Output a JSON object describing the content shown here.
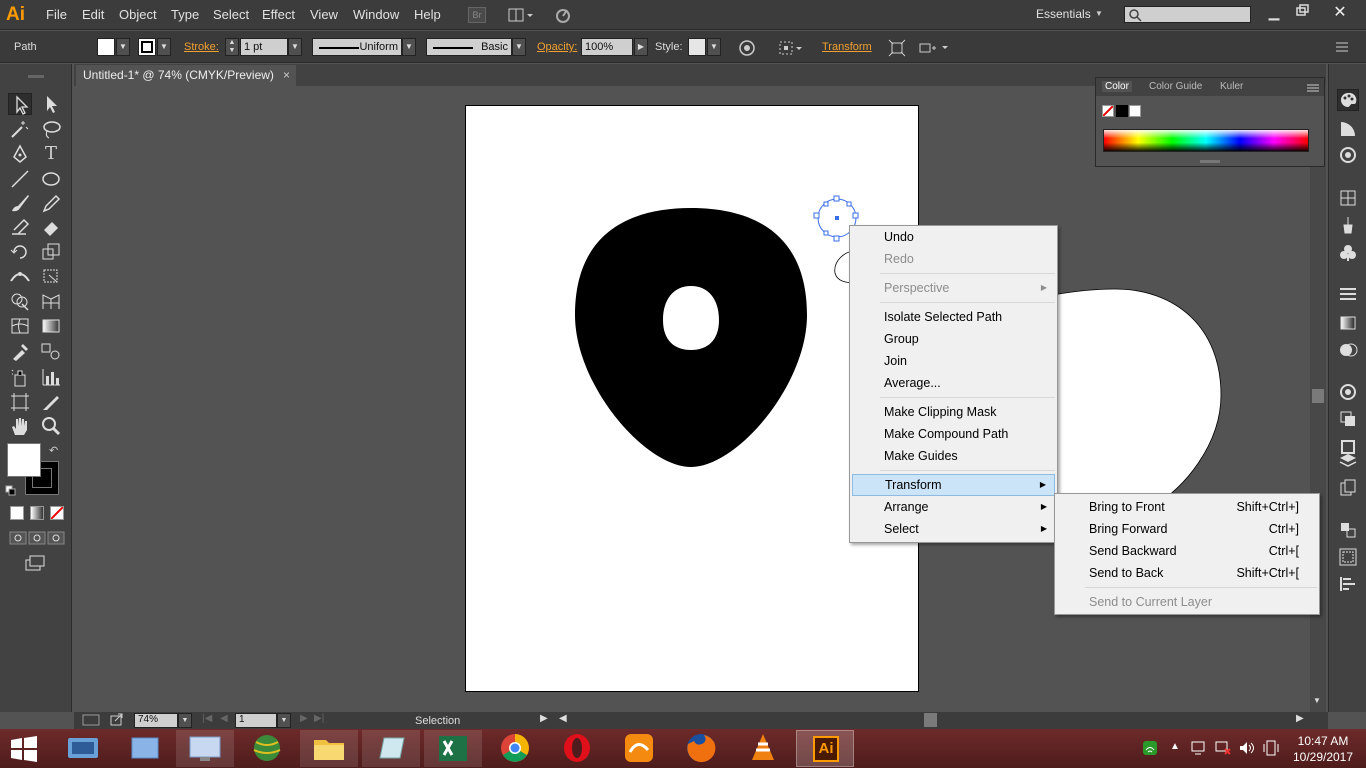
{
  "app": {
    "logo": "Ai",
    "workspace": "Essentials"
  },
  "menubar": {
    "items": [
      "File",
      "Edit",
      "Object",
      "Type",
      "Select",
      "Effect",
      "View",
      "Window",
      "Help"
    ],
    "bridge": "Br"
  },
  "controlbar": {
    "selection_type": "Path",
    "stroke_label": "Stroke:",
    "stroke_weight": "1 pt",
    "profile": "Uniform",
    "brush": "Basic",
    "opacity_label": "Opacity:",
    "opacity_value": "100%",
    "style_label": "Style:",
    "transform_link": "Transform"
  },
  "document": {
    "tab_title": "Untitled-1* @ 74% (CMYK/Preview)",
    "close": "×"
  },
  "color_panel": {
    "tabs": [
      "Color",
      "Color Guide",
      "Kuler"
    ]
  },
  "status_bar": {
    "zoom": "74%",
    "artboard_num": "1",
    "tool": "Selection"
  },
  "context_menu": {
    "items": [
      {
        "label": "Undo",
        "enabled": true
      },
      {
        "label": "Redo",
        "enabled": false
      },
      {
        "label": "Perspective",
        "enabled": false,
        "submenu": true
      },
      {
        "label": "Isolate Selected Path",
        "enabled": true
      },
      {
        "label": "Group",
        "enabled": true
      },
      {
        "label": "Join",
        "enabled": true
      },
      {
        "label": "Average...",
        "enabled": true
      },
      {
        "label": "Make Clipping Mask",
        "enabled": true
      },
      {
        "label": "Make Compound Path",
        "enabled": true
      },
      {
        "label": "Make Guides",
        "enabled": true
      },
      {
        "label": "Transform",
        "enabled": true,
        "submenu": true,
        "highlighted": true
      },
      {
        "label": "Arrange",
        "enabled": true,
        "submenu": true
      },
      {
        "label": "Select",
        "enabled": true,
        "submenu": true
      }
    ]
  },
  "arrange_submenu": {
    "items": [
      {
        "label": "Bring to Front",
        "shortcut": "Shift+Ctrl+]"
      },
      {
        "label": "Bring Forward",
        "shortcut": "Ctrl+]"
      },
      {
        "label": "Send Backward",
        "shortcut": "Ctrl+["
      },
      {
        "label": "Send to Back",
        "shortcut": "Shift+Ctrl+["
      },
      {
        "label": "Send to Current Layer",
        "shortcut": "",
        "enabled": false
      }
    ]
  },
  "taskbar": {
    "apps": [
      "windows-start",
      "idm",
      "file-sync",
      "remote-desktop",
      "globe-browser",
      "file-explorer",
      "notepad",
      "excel",
      "chrome",
      "opera",
      "uc-browser",
      "firefox",
      "vlc",
      "illustrator"
    ],
    "illustrator_label": "Ai",
    "time": "10:47 AM",
    "date": "10/29/2017"
  },
  "colors": {
    "accent": "#ff9a00",
    "selection_blue": "#3a6ee8",
    "menu_highlight": "#cce4f7",
    "taskbar": "#5a2020"
  }
}
